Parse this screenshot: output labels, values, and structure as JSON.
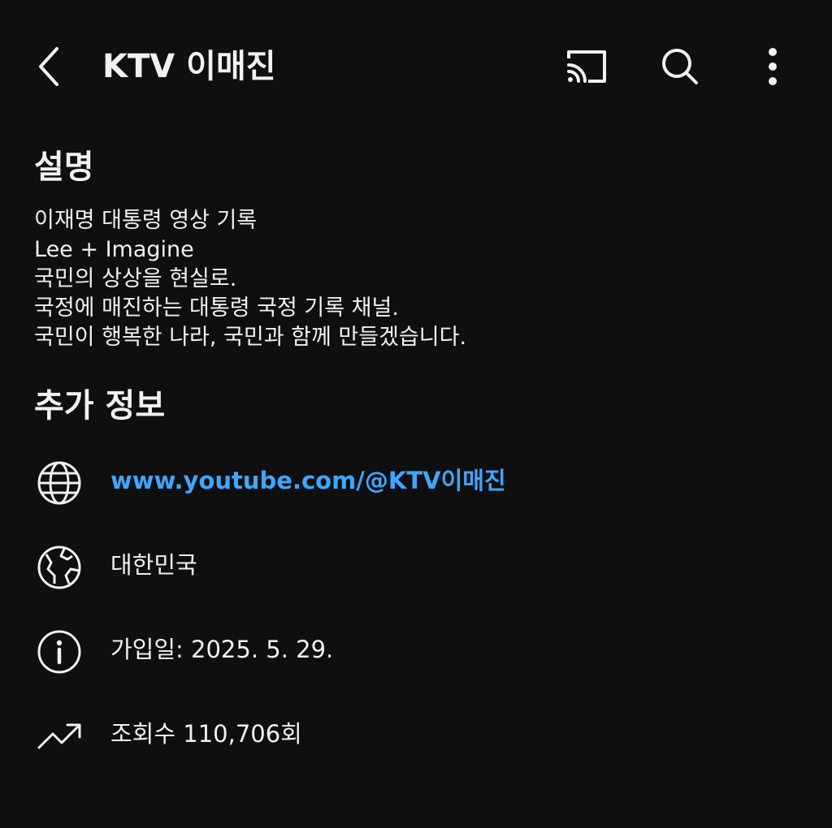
{
  "header": {
    "back_icon": "back-arrow-icon",
    "title": "KTV 이매진",
    "cast_icon": "cast-icon",
    "search_icon": "search-icon",
    "more_icon": "more-vertical-icon"
  },
  "description": {
    "heading": "설명",
    "lines": [
      "이재명 대통령 영상 기록",
      "Lee + Imagine",
      "국민의 상상을 현실로.",
      "국정에 매진하는 대통령 국정 기록 채널.",
      "국민이 행복한 나라, 국민과 함께 만들겠습니다."
    ]
  },
  "more_info": {
    "heading": "추가 정보",
    "link": {
      "icon": "globe-icon",
      "text": "www.youtube.com/@KTV이매진"
    },
    "country": {
      "icon": "earth-icon",
      "text": "대한민국"
    },
    "joined": {
      "icon": "info-icon",
      "text": "가입일: 2025. 5. 29."
    },
    "views": {
      "icon": "trending-up-icon",
      "text": "조회수 110,706회"
    }
  },
  "colors": {
    "background": "#0f0f0f",
    "text": "#f1f1f1",
    "link": "#3ea6ff"
  }
}
